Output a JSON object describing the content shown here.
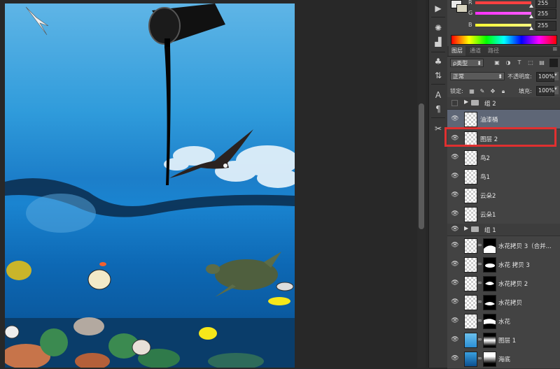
{
  "colors": {
    "highlight": "#e03030",
    "selected_layer": "#5e6676",
    "g_slider": "#e040e0",
    "b_slider": "#e8e020"
  },
  "color_panel": {
    "channels": [
      {
        "label": "R",
        "value": "255"
      },
      {
        "label": "G",
        "value": "255"
      },
      {
        "label": "B",
        "value": "255"
      }
    ]
  },
  "tabs": [
    {
      "label": "图层",
      "active": true
    },
    {
      "label": "通道",
      "active": false
    },
    {
      "label": "路径",
      "active": false
    }
  ],
  "layers_panel": {
    "filter_label": "ρ类型",
    "blend_mode": "正常",
    "opacity_label": "不透明度:",
    "opacity_value": "100%",
    "lock_label": "锁定:",
    "fill_label": "填充:",
    "fill_value": "100%"
  },
  "icons": {
    "filter": [
      "image-filter-icon",
      "adjustment-filter-icon",
      "type-filter-icon",
      "shape-filter-icon",
      "smart-filter-icon"
    ],
    "lock": [
      "lock-transparent-icon",
      "lock-paint-icon",
      "lock-move-icon",
      "lock-all-icon"
    ],
    "tools": [
      "play-icon",
      "brightness-icon",
      "histogram-icon",
      "clone-source-icon",
      "adjust-icon",
      "character-icon",
      "paragraph-icon",
      "tools-icon"
    ]
  },
  "layers": [
    {
      "type": "group",
      "name": "组 2",
      "visible": false
    },
    {
      "type": "layer",
      "name": "油漆桶",
      "selected": true,
      "mask": false
    },
    {
      "type": "layer",
      "name": "图层 2",
      "selected": false,
      "mask": false,
      "highlighted": true
    },
    {
      "type": "layer",
      "name": "鸟2",
      "selected": false,
      "mask": false
    },
    {
      "type": "layer",
      "name": "鸟1",
      "selected": false,
      "mask": false
    },
    {
      "type": "layer",
      "name": "云朵2",
      "selected": false,
      "mask": false
    },
    {
      "type": "layer",
      "name": "云朵1",
      "selected": false,
      "mask": false
    },
    {
      "type": "group",
      "name": "组 1",
      "visible": true
    },
    {
      "type": "layer",
      "name": "水花拷贝 3（合并...",
      "selected": false,
      "mask": true
    },
    {
      "type": "layer",
      "name": "水花 拷贝 3",
      "selected": false,
      "mask": true
    },
    {
      "type": "layer",
      "name": "水花拷贝 2",
      "selected": false,
      "mask": true
    },
    {
      "type": "layer",
      "name": "水花拷贝",
      "selected": false,
      "mask": true
    },
    {
      "type": "layer",
      "name": "水花",
      "selected": false,
      "mask": true
    },
    {
      "type": "layer",
      "name": "图层 1",
      "selected": false,
      "mask": true
    },
    {
      "type": "layer",
      "name": "海底",
      "selected": false,
      "mask": true
    }
  ]
}
